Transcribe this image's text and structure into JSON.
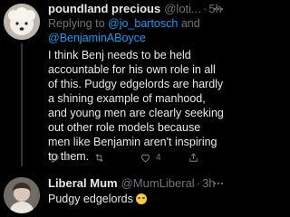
{
  "tweet1": {
    "name": "poundland precious",
    "handle": "@loti...",
    "separator": "·",
    "time": "5h",
    "reply_prefix": "Replying to ",
    "reply_mention1": "@jo_bartosch",
    "reply_and": " and",
    "reply_mention2": "@BenjaminABoyce",
    "text": "I think Benj needs to be held accountable for his own role in all of this. Pudgy edgelords are hardly a shining example of manhood, and young men are clearly seeking out other role models because men like Benjamin aren't inspiring to them.",
    "reply_count": "1",
    "like_count": "4"
  },
  "tweet2": {
    "name": "Liberal Mum",
    "handle": "@MumLiberal",
    "separator": "·",
    "time": "3h",
    "text": "Pudgy edgelords",
    "emoji": "laughing-face-emoji"
  },
  "icons": {
    "more": "more-horizontal-icon",
    "reply": "reply-icon",
    "retweet": "retweet-icon",
    "like": "heart-icon",
    "share": "share-icon"
  },
  "colors": {
    "link": "#1d9bf0",
    "muted": "#71767b",
    "text": "#e7e9ea"
  }
}
